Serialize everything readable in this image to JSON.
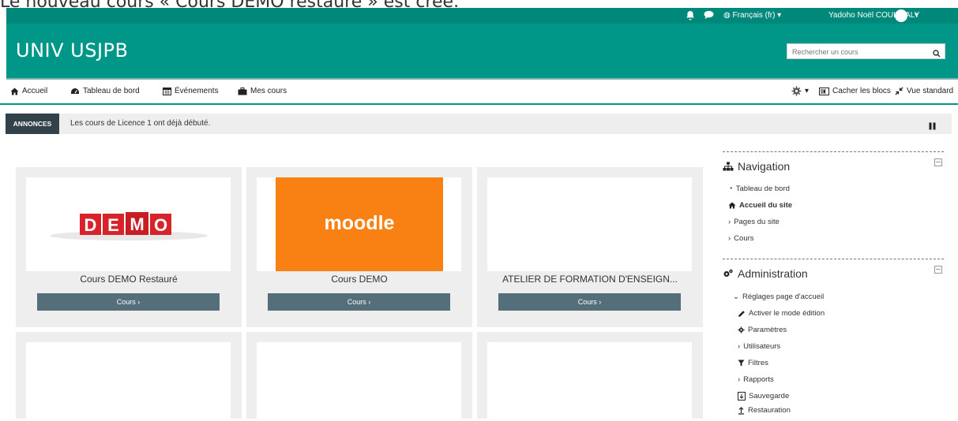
{
  "notice": "Le nouveau cours « Cours DEMO restauré » est créé.",
  "topbar": {
    "language": "Français (fr) ▾",
    "user_name": "Yadoho Noël COULIBALY",
    "menu_caret": "▾"
  },
  "header": {
    "brand": "UNIV USJPB",
    "search_placeholder": "Rechercher un cours"
  },
  "nav": {
    "items": [
      "Accueil",
      "Tableau de bord",
      "Événements",
      "Mes cours"
    ],
    "right": {
      "gear_caret": "▾",
      "hide_blocks": "Cacher les blocs",
      "standard_view": "Vue standard"
    }
  },
  "announcement": {
    "tag": "ANNONCES",
    "message": "Les cours de Licence 1 ont déjà débuté."
  },
  "courses": [
    {
      "title": "Cours DEMO Restauré",
      "button": "Cours ›",
      "image_text": "DEMO"
    },
    {
      "title": "Cours DEMO",
      "button": "Cours ›",
      "image_text": "moodle"
    },
    {
      "title": "ATELIER DE FORMATION D'ENSEIGN...",
      "button": "Cours ›",
      "image_text": ""
    },
    {
      "title": "",
      "button": "",
      "image_text": ""
    },
    {
      "title": "",
      "button": "",
      "image_text": ""
    },
    {
      "title": "",
      "button": "",
      "image_text": ""
    }
  ],
  "navigation_block": {
    "title": "Navigation",
    "items": [
      "Tableau de bord",
      "Accueil du site",
      "Pages du site",
      "Cours"
    ]
  },
  "administration_block": {
    "title": "Administration",
    "items": [
      "Réglages page d'accueil",
      "Activer le mode édition",
      "Paramètres",
      "Utilisateurs",
      "Filtres",
      "Rapports",
      "Sauvegarde",
      "Restauration"
    ]
  },
  "colors": {
    "brand_teal": "#009688",
    "topbar_teal": "#00897b",
    "button_slate": "#546e7a",
    "announce_tag": "#33414a",
    "demo_red": "#d9232b",
    "moodle_orange": "#f98012"
  }
}
